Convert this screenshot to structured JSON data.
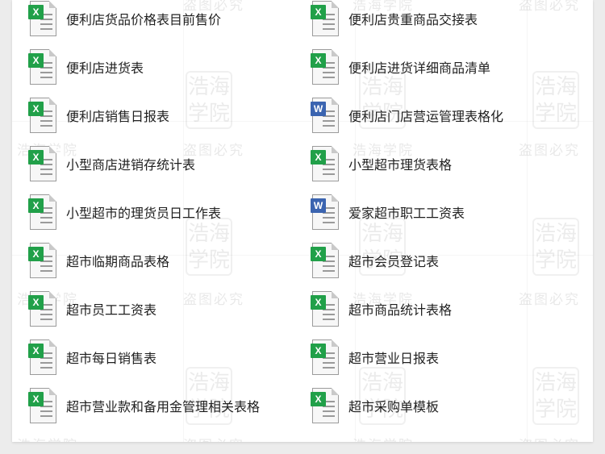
{
  "watermark": {
    "site": "浩海学院",
    "warning": "盗图必究",
    "seal": "浩海学院"
  },
  "colors": {
    "excel": "#21a049",
    "word": "#3b64b0"
  },
  "files_left": [
    {
      "name": "便利店货品价格表目前售价",
      "type": "excel",
      "badge": "X"
    },
    {
      "name": "便利店进货表",
      "type": "excel",
      "badge": "X"
    },
    {
      "name": "便利店销售日报表",
      "type": "excel",
      "badge": "X"
    },
    {
      "name": "小型商店进销存统计表",
      "type": "excel",
      "badge": "X"
    },
    {
      "name": "小型超市的理货员日工作表",
      "type": "excel",
      "badge": "X"
    },
    {
      "name": "超市临期商品表格",
      "type": "excel",
      "badge": "X"
    },
    {
      "name": "超市员工工资表",
      "type": "excel",
      "badge": "X"
    },
    {
      "name": "超市每日销售表",
      "type": "excel",
      "badge": "X"
    },
    {
      "name": "超市营业款和备用金管理相关表格",
      "type": "excel",
      "badge": "X"
    }
  ],
  "files_right": [
    {
      "name": "便利店贵重商品交接表",
      "type": "excel",
      "badge": "X"
    },
    {
      "name": "便利店进货详细商品清单",
      "type": "excel",
      "badge": "X"
    },
    {
      "name": "便利店门店营运管理表格化",
      "type": "word",
      "badge": "W"
    },
    {
      "name": "小型超市理货表格",
      "type": "excel",
      "badge": "X"
    },
    {
      "name": "爱家超市职工工资表",
      "type": "word",
      "badge": "W"
    },
    {
      "name": "超市会员登记表",
      "type": "excel",
      "badge": "X"
    },
    {
      "name": "超市商品统计表格",
      "type": "excel",
      "badge": "X"
    },
    {
      "name": "超市营业日报表",
      "type": "excel",
      "badge": "X"
    },
    {
      "name": "超市采购单模板",
      "type": "excel",
      "badge": "X"
    }
  ]
}
